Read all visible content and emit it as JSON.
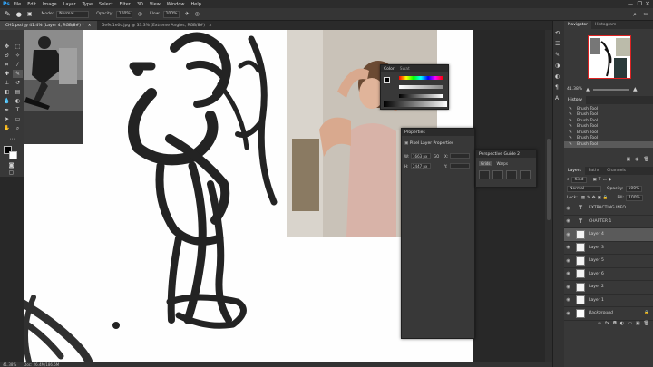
{
  "app": {
    "logo": "Ps"
  },
  "menu": [
    "File",
    "Edit",
    "Image",
    "Layer",
    "Type",
    "Select",
    "Filter",
    "3D",
    "View",
    "Window",
    "Help"
  ],
  "options": {
    "mode_label": "Mode:",
    "mode_value": "Normal",
    "opacity_label": "Opacity:",
    "opacity_value": "100%",
    "flow_label": "Flow:",
    "flow_value": "100%"
  },
  "tabs": [
    {
      "label": "CH1.psd @ 41.4% (Layer 4, RGB/8#) *"
    },
    {
      "label": "5e9d1e0c.jpg @ 33.3% (Extreme Angles, RGB/8#)"
    }
  ],
  "status": {
    "zoom": "41.38%",
    "doc": "Doc: 26.4M/186.5M"
  },
  "color_panel": {
    "tabs": [
      "Color",
      "Swat"
    ]
  },
  "properties_panel": {
    "title": "Properties",
    "section": "Pixel Layer Properties",
    "w_label": "W:",
    "w_value": "1663 px",
    "h_label": "H:",
    "h_value": "2447 px",
    "x_label": "X:",
    "y_label": "Y:",
    "go_label": "GO"
  },
  "perspective_panel": {
    "title": "Perspective Guide 2",
    "tabs": [
      "Grids",
      "Warps"
    ]
  },
  "navigator": {
    "tabs": [
      "Navigator",
      "Histogram"
    ],
    "zoom": "41.38%"
  },
  "history": {
    "tabs": [
      "History"
    ],
    "items": [
      "Brush Tool",
      "Brush Tool",
      "Brush Tool",
      "Brush Tool",
      "Brush Tool",
      "Brush Tool",
      "Brush Tool"
    ]
  },
  "layers_panel": {
    "tabs": [
      "Layers",
      "Paths",
      "Channels"
    ],
    "kind_label": "Kind",
    "blend": "Normal",
    "opacity_label": "Opacity:",
    "opacity_value": "100%",
    "lock_label": "Lock:",
    "fill_label": "Fill:",
    "fill_value": "100%",
    "layers": [
      {
        "name": "EXTRACTING INFO",
        "type": "text",
        "selected": false
      },
      {
        "name": "CHAPTER 1",
        "type": "text",
        "selected": false
      },
      {
        "name": "Layer 4",
        "type": "pixel",
        "selected": true
      },
      {
        "name": "Layer 3",
        "type": "pixel",
        "selected": false
      },
      {
        "name": "Layer 5",
        "type": "pixel",
        "selected": false
      },
      {
        "name": "Layer 6",
        "type": "pixel",
        "selected": false
      },
      {
        "name": "Layer 2",
        "type": "pixel",
        "selected": false
      },
      {
        "name": "Layer 1",
        "type": "pixel",
        "selected": false
      },
      {
        "name": "Background",
        "type": "background",
        "selected": false
      }
    ]
  },
  "colors": {
    "accent": "#31a8ff",
    "panel": "#383838",
    "canvas": "#ffffff"
  }
}
